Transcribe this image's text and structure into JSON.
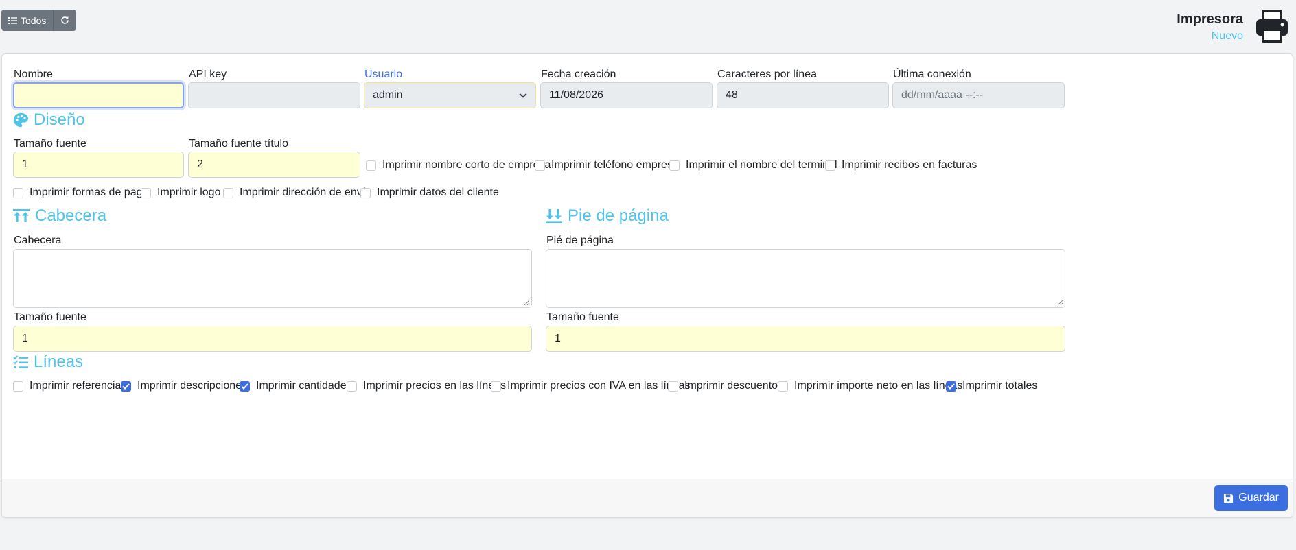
{
  "toolbar": {
    "all_label": "Todos",
    "title": "Impresora",
    "subtitle": "Nuevo"
  },
  "form": {
    "nombre_label": "Nombre",
    "nombre_value": "",
    "apikey_label": "API key",
    "apikey_value": "",
    "usuario_label": "Usuario",
    "usuario_value": "admin",
    "fecha_label": "Fecha creación",
    "fecha_value": "11/08/2026",
    "caracteres_label": "Caracteres por línea",
    "caracteres_value": "48",
    "ultima_label": "Última conexión",
    "ultima_placeholder": "dd/mm/aaaa --:--"
  },
  "diseno": {
    "title": "Diseño",
    "tamano_fuente_label": "Tamaño fuente",
    "tamano_fuente_value": "1",
    "tamano_titulo_label": "Tamaño fuente título",
    "tamano_titulo_value": "2",
    "checks": [
      {
        "label": "Imprimir nombre corto de empresa",
        "checked": false
      },
      {
        "label": "Imprimir teléfono empresa",
        "checked": false
      },
      {
        "label": "Imprimir el nombre del terminal",
        "checked": false
      },
      {
        "label": "Imprimir recibos en facturas",
        "checked": false
      },
      {
        "label": "Imprimir formas de pago",
        "checked": false
      },
      {
        "label": "Imprimir logo",
        "checked": false
      },
      {
        "label": "Imprimir dirección de envío",
        "checked": false
      },
      {
        "label": "Imprimir datos del cliente",
        "checked": false
      }
    ]
  },
  "cabecera": {
    "title": "Cabecera",
    "field_label": "Cabecera",
    "tamano_label": "Tamaño fuente",
    "tamano_value": "1"
  },
  "pie": {
    "title": "Pie de página",
    "field_label": "Pié de página",
    "tamano_label": "Tamaño fuente",
    "tamano_value": "1"
  },
  "lineas": {
    "title": "Líneas",
    "checks": [
      {
        "label": "Imprimir referencias",
        "checked": false
      },
      {
        "label": "Imprimir descripciones",
        "checked": true
      },
      {
        "label": "Imprimir cantidades",
        "checked": true
      },
      {
        "label": "Imprimir precios en las líneas",
        "checked": false
      },
      {
        "label": "Imprimir precios con IVA en las líneas",
        "checked": false
      },
      {
        "label": "Imprimir descuentos",
        "checked": false
      },
      {
        "label": "Imprimir importe neto en las líneas",
        "checked": false
      },
      {
        "label": "Imprimir totales",
        "checked": true
      }
    ]
  },
  "footer": {
    "save_label": "Guardar"
  },
  "colors": {
    "accent": "#4fc3e8",
    "primary": "#3d6ee0",
    "secondary": "#6c757d",
    "input_highlight": "#ffffd6"
  },
  "icons": {
    "list": "list-icon",
    "refresh": "refresh-icon",
    "printer": "printer-icon",
    "palette": "palette-icon",
    "header": "arrows-up-to-line-icon",
    "footer": "arrows-down-to-line-icon",
    "lines": "list-check-icon",
    "save": "floppy-disk-icon"
  }
}
